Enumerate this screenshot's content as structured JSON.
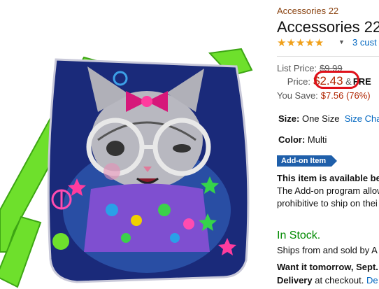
{
  "product": {
    "brand": "Accessories 22",
    "title": "Accessories 22",
    "rating_stars": "★★★★★",
    "reviews_link": "3 cust",
    "colors": {
      "price_red": "#b12704",
      "link_blue": "#0066c0",
      "stock_green": "#008a00",
      "badge_blue": "#1f5faa",
      "highlight_oval": "#e0101a"
    }
  },
  "pricing": {
    "list_label": "List Price:",
    "list_value": "$9.99",
    "price_label": "Price:",
    "price_value": "$2.43",
    "price_suffix": "&",
    "free_text": "FRE",
    "save_label": "You Save:",
    "save_value": "$7.56 (76%)"
  },
  "options": {
    "size_label": "Size:",
    "size_value": "One Size",
    "size_chart_link": "Size Cha",
    "color_label": "Color:",
    "color_value": "Multi"
  },
  "addon": {
    "badge": "Add-on Item",
    "headline": "This item is available be",
    "line1": "The Add-on program allow",
    "line2": "prohibitive to ship on thei"
  },
  "stock": {
    "status": "In Stock.",
    "ships": "Ships from and sold by A",
    "want": "Want it tomorrow, Sept.",
    "delivery_label": "Delivery",
    "delivery_text": "at checkout.",
    "delivery_link": "De"
  }
}
